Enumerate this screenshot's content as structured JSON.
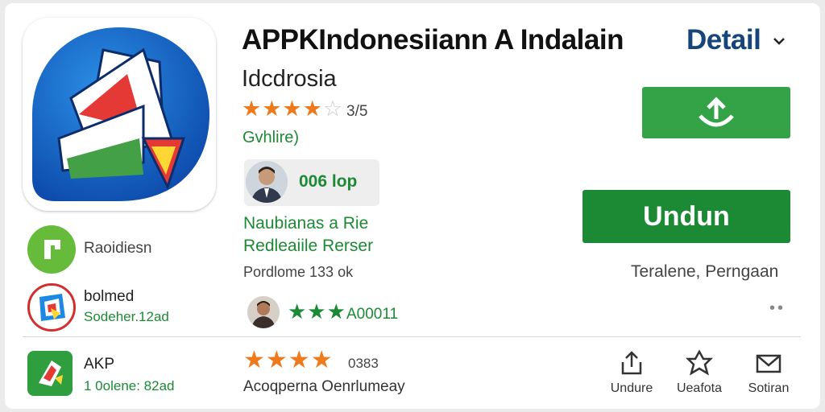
{
  "app": {
    "title": "APPKIndonesiiann A Indalain",
    "detail_link": "Detail",
    "developer": "Idcdrosia",
    "rating_value": "3/5",
    "category": "Gvhlire)",
    "downloads_chip": "006 lop",
    "description_line1": "Naubianas a Rie",
    "description_line2": "Redleaiile Rerser",
    "size_line": "Pordlome 133 ok",
    "install_label": "Undun",
    "install_note": "Teralene, Perngaan",
    "reviewer_rating_text": "A00011",
    "stars": 4.5
  },
  "related": [
    {
      "title": "Raoidiesn",
      "subtitle": ""
    },
    {
      "title": "bolmed",
      "subtitle": "Sodeher.12ad"
    },
    {
      "title": "AKP",
      "subtitle": "1 0olene: 82ad"
    }
  ],
  "bottom_row": {
    "stars": 3.5,
    "rating_text": "0383",
    "caption": "Acoqperna Oenrlumeay"
  },
  "actions": [
    {
      "label": "Undure",
      "icon": "share-icon"
    },
    {
      "label": "Ueafota",
      "icon": "bookmark-icon"
    },
    {
      "label": "Sotiran",
      "icon": "mail-icon"
    }
  ],
  "colors": {
    "accent_green": "#1c8a35",
    "button_green": "#34a347",
    "star_orange": "#ee7a1b",
    "link_blue": "#15457a",
    "icon_blue": "#1565c0"
  }
}
